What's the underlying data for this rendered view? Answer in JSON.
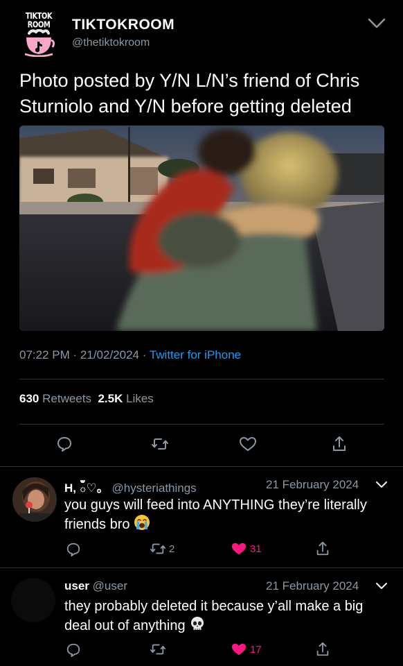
{
  "tweet": {
    "avatar_text": "TIKTOK ROOM",
    "display_name": "TIKTOKROOM",
    "handle": "@thetiktokroom",
    "text": "Photo posted by Y/N L/N’s friend of Chris Sturniolo and Y/N before getting deleted",
    "time": "07:22 PM",
    "date": "21/02/2024",
    "source": "Twitter for iPhone",
    "sep": "·",
    "retweets_count": "630",
    "retweets_label": "Retweets",
    "likes_count": "2.5K",
    "likes_label": "Likes"
  },
  "replies": [
    {
      "display_name": "H, ఀ♡。",
      "handle": "@hysteriathings",
      "date": "21 February 2024",
      "text": "you guys will feed into ANYTHING they’re literally friends bro",
      "emoji": "crying-face",
      "retweet_count": "2",
      "like_count": "31"
    },
    {
      "display_name": "user",
      "handle": "@user",
      "date": "21 February 2024",
      "text": "they probably deleted it because y’all make a big deal out of anything",
      "emoji": "skull",
      "retweet_count": "",
      "like_count": "17"
    }
  ],
  "colors": {
    "background": "#000000",
    "accent": "#1d9bf0",
    "muted": "#8b98a5",
    "like_active": "#f91880",
    "divider": "#2f3336"
  },
  "icons": [
    "reply-icon",
    "retweet-icon",
    "like-icon",
    "share-icon",
    "chevron-down-icon"
  ]
}
